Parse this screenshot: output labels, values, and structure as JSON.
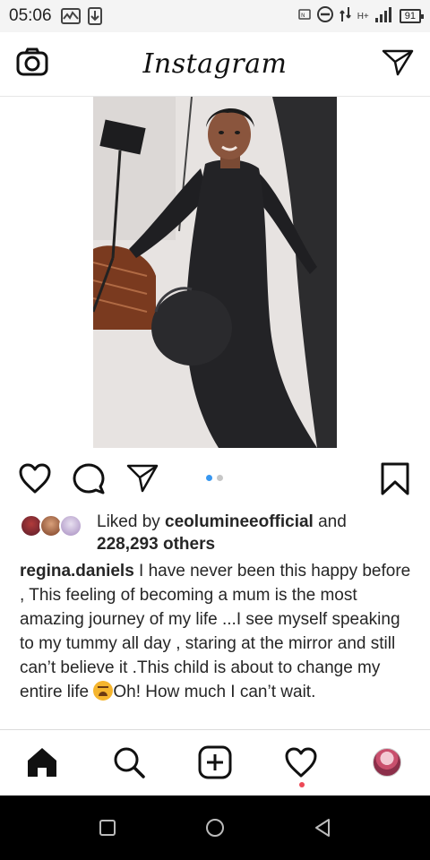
{
  "status_bar": {
    "time": "05:06",
    "battery": "91",
    "network": "H+",
    "icons": [
      "activity-icon",
      "download-icon",
      "nfc-icon",
      "do-not-disturb-icon",
      "vibrate-icon",
      "signal-icon",
      "battery-icon"
    ]
  },
  "app_bar": {
    "logo": "Instagram",
    "left_icon": "camera-icon",
    "right_icon": "direct-message-icon"
  },
  "post": {
    "image_icon": "post-photo",
    "actions": [
      "like-icon",
      "comment-icon",
      "share-icon",
      "save-icon"
    ],
    "carousel": {
      "count": 2,
      "active": 1
    },
    "likes": {
      "prefix": "Liked by ",
      "user": "ceolumineeofficial",
      "and": " and",
      "others": "228,293 others"
    },
    "caption": {
      "username": "regina.daniels",
      "text_before_emoji": " I have never been this happy before , This feeling of becoming a mum is the most amazing journey of my life ...I see myself speaking to my tummy all day , staring at the mirror and still can’t believe it .This child is about to change my entire life ",
      "emoji": "weary-face-emoji",
      "text_after_emoji": "Oh! How much I can’t wait."
    }
  },
  "bottom_nav": {
    "items": [
      "home-icon",
      "search-icon",
      "new-post-icon",
      "activity-heart-icon",
      "profile-avatar"
    ],
    "active": "home-icon"
  },
  "system_nav": {
    "items": [
      "recents-icon",
      "home-circle-icon",
      "back-icon"
    ]
  },
  "colors": {
    "accent": "#3897f0",
    "notification": "#ed4956",
    "text": "#262626"
  }
}
